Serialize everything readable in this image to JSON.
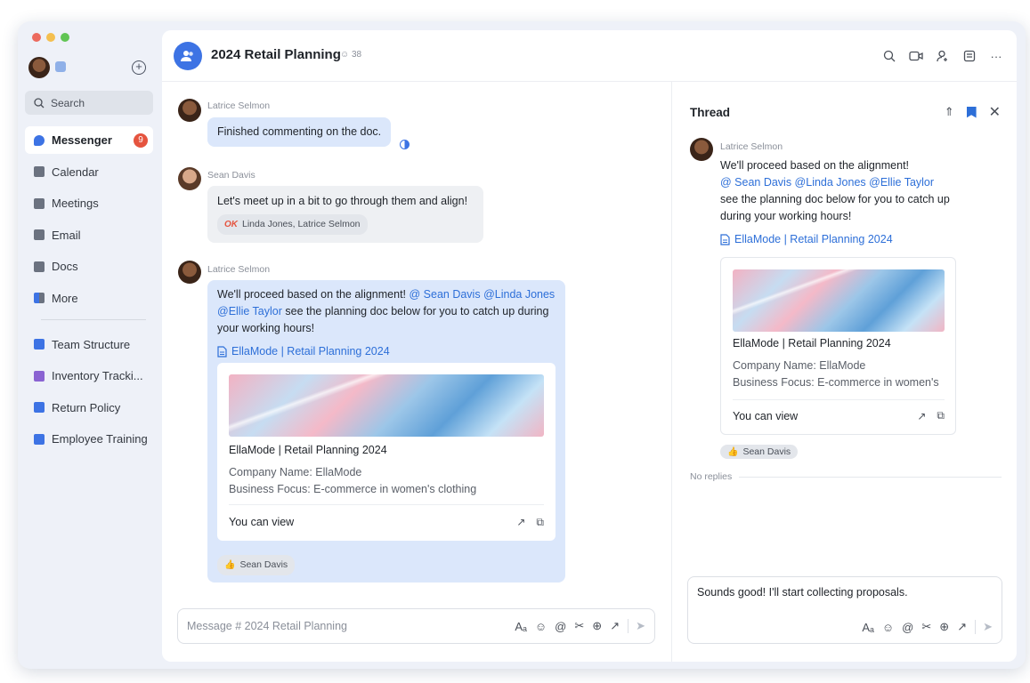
{
  "window": {
    "controls": [
      "#ec6a5e",
      "#f4bf4f",
      "#61c554"
    ]
  },
  "sidebar": {
    "search": "Search",
    "items": [
      {
        "label": "Messenger",
        "badge": "9",
        "color": "#3d73e4"
      },
      {
        "label": "Calendar",
        "color": "#6b7280"
      },
      {
        "label": "Meetings",
        "color": "#6b7280"
      },
      {
        "label": "Email",
        "color": "#6b7280"
      },
      {
        "label": "Docs",
        "color": "#6b7280"
      },
      {
        "label": "More",
        "color": "#3d73e4"
      }
    ],
    "shortcuts": [
      {
        "label": "Team Structure",
        "color": "#3d73e4"
      },
      {
        "label": "Inventory Tracki...",
        "color": "#8a63d2"
      },
      {
        "label": "Return Policy",
        "color": "#3d73e4"
      },
      {
        "label": "Employee Training",
        "color": "#3d73e4"
      }
    ]
  },
  "header": {
    "title": "2024 Retail Planning",
    "member_count": "38"
  },
  "chat": {
    "msg1": {
      "sender": "Latrice Selmon",
      "text": "Finished commenting on the doc."
    },
    "msg2": {
      "sender": "Sean Davis",
      "text": "Let's meet up in a bit to go through them and align!",
      "reaction_emoji": "OK",
      "reaction_users": "Linda Jones, Latrice Selmon"
    },
    "msg3": {
      "sender": "Latrice Selmon",
      "text_a": "We'll proceed based on the alignment! ",
      "mention1": "@ Sean Davis",
      "mention2": "@Linda Jones",
      "mention3": "@Ellie Taylor",
      "text_b": " see the planning doc below for you to catch up during your working hours!",
      "doc_link": "EllaMode | Retail Planning 2024",
      "card_title": "EllaMode | Retail Planning 2024",
      "card_line1": "Company Name: EllaMode",
      "card_line2": "Business Focus: E-commerce in women's clothing",
      "card_footer": "You can view",
      "reaction_user": "Sean Davis"
    },
    "composer_placeholder": "Message # 2024 Retail Planning"
  },
  "thread": {
    "title": "Thread",
    "sender": "Latrice Selmon",
    "line1": "We'll proceed based on the alignment!",
    "mentions": "@ Sean Davis @Linda Jones @Ellie Taylor",
    "line2": "see the planning doc below for you to catch up during your working hours!",
    "doc_link": "EllaMode | Retail Planning 2024",
    "card_title": "EllaMode | Retail Planning 2024",
    "card_line1": "Company Name: EllaMode",
    "card_line2": "Business Focus: E-commerce in women's",
    "card_footer": "You can view",
    "reaction_user": "Sean Davis",
    "no_replies": "No replies",
    "reply_text": "Sounds good! I'll start collecting proposals."
  }
}
